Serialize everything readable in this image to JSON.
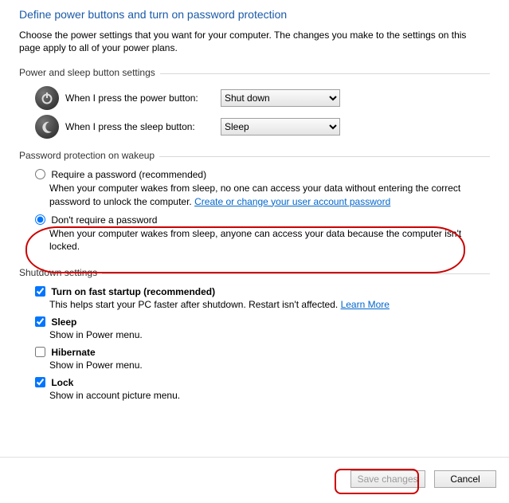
{
  "header": "Define power buttons and turn on password protection",
  "intro": "Choose the power settings that you want for your computer. The changes you make to the settings on this page apply to all of your power plans.",
  "sections": {
    "buttons": {
      "title": "Power and sleep button settings",
      "power_label": "When I press the power button:",
      "power_value": "Shut down",
      "sleep_label": "When I press the sleep button:",
      "sleep_value": "Sleep"
    },
    "password": {
      "title": "Password protection on wakeup",
      "opt1_label": "Require a password (recommended)",
      "opt1_desc_a": "When your computer wakes from sleep, no one can access your data without entering the correct password to unlock the computer. ",
      "opt1_link": "Create or change your user account password",
      "opt2_label": "Don't require a password",
      "opt2_desc": "When your computer wakes from sleep, anyone can access your data because the computer isn't locked."
    },
    "shutdown": {
      "title": "Shutdown settings",
      "fast_label": "Turn on fast startup (recommended)",
      "fast_desc": "This helps start your PC faster after shutdown. Restart isn't affected. ",
      "fast_link": "Learn More",
      "sleep_label": "Sleep",
      "sleep_desc": "Show in Power menu.",
      "hib_label": "Hibernate",
      "hib_desc": "Show in Power menu.",
      "lock_label": "Lock",
      "lock_desc": "Show in account picture menu."
    }
  },
  "footer": {
    "save": "Save changes",
    "cancel": "Cancel"
  }
}
